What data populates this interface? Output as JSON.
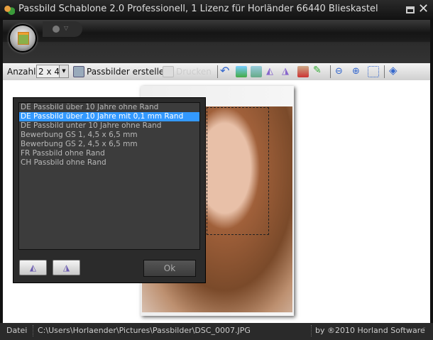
{
  "window": {
    "title": "Passbild Schablone 2.0 Professionell, 1 Lizenz für Horländer 66440 Blieskastel"
  },
  "toolbar": {
    "anzahl_label": "Anzahl",
    "anzahl_value": "2 x 4",
    "create_label": "Passbilder erstellen",
    "print_label": "Drucken"
  },
  "dialog": {
    "items": [
      "DE Passbild über 10 Jahre ohne Rand",
      "DE Passbild über 10 Jahre mit 0,1 mm Rand",
      "DE Passbild unter 10 Jahre ohne Rand",
      "Bewerbung GS 1, 4,5 x 6,5 mm",
      "Bewerbung GS 2, 4,5 x 6,5 mm",
      "FR Passbild ohne Rand",
      "CH Passbild ohne Rand"
    ],
    "selected_index": 1,
    "ok_label": "Ok"
  },
  "status": {
    "label": "Datei",
    "path": "C:\\Users\\Horlaender\\Pictures\\Passbilder\\DSC_0007.JPG",
    "copyright": "by ®2010 Horland Software"
  }
}
